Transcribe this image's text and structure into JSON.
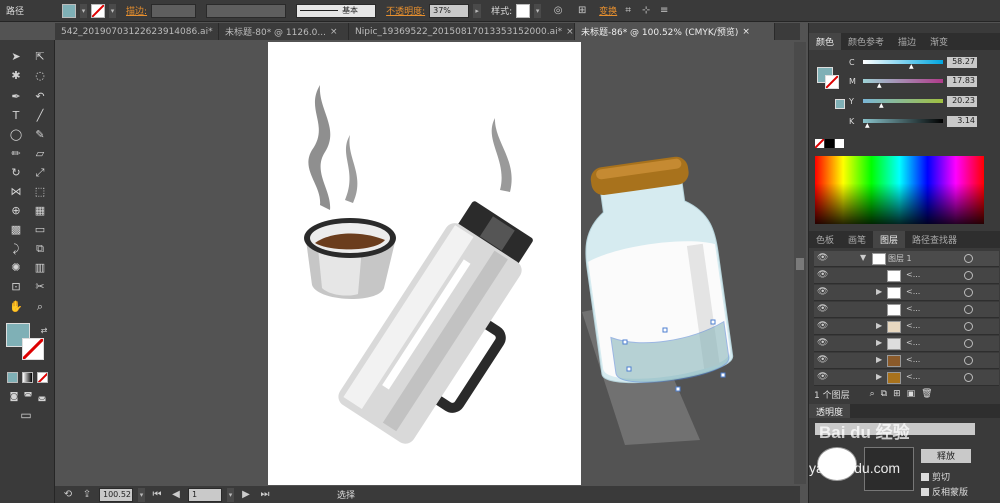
{
  "control_bar": {
    "path_label": "路径",
    "stroke_label": "描边:",
    "style_label": "基本",
    "opacity_label": "不透明度:",
    "opacity_value": "37%",
    "style2_label": "样式:",
    "transform_label": "变换"
  },
  "tabs": [
    {
      "label": "542_20190703122623914086.ai*",
      "close": "×"
    },
    {
      "label": "未标题-80* @ 1126.0...",
      "close": "×"
    },
    {
      "label": "Nipic_19369522_20150817013353152000.ai*",
      "close": "×"
    },
    {
      "label": "未标题-86* @ 100.52% (CMYK/预览)",
      "close": "×"
    }
  ],
  "status": {
    "zoom": "100.52",
    "page": "1",
    "mode": "选择"
  },
  "color_panel": {
    "tabs": [
      "颜色",
      "颜色参考",
      "描边",
      "渐变"
    ],
    "c": "58.27",
    "m": "17.83",
    "y": "20.23",
    "k": "3.14",
    "cl": "C",
    "ml": "M",
    "yl": "Y",
    "kl": "K"
  },
  "layers_panel": {
    "tabs": [
      "色板",
      "画笔",
      "图层",
      "路径查找器"
    ],
    "layer_name": "图层 1",
    "sublayer_names": [
      "<...",
      "<...",
      "<...",
      "<...",
      "<...",
      "<...",
      "<..."
    ],
    "footer": "1 个图层"
  },
  "transparency_panel": {
    "title": "透明度",
    "release": "释放",
    "clip": "剪切",
    "invert": "反相蒙版"
  },
  "watermark": {
    "text": "yan.baidu.com",
    "logo": "Bai du 经验"
  },
  "colors": {
    "accent": "#6e9fa6",
    "fill": "#7fb0b6"
  }
}
